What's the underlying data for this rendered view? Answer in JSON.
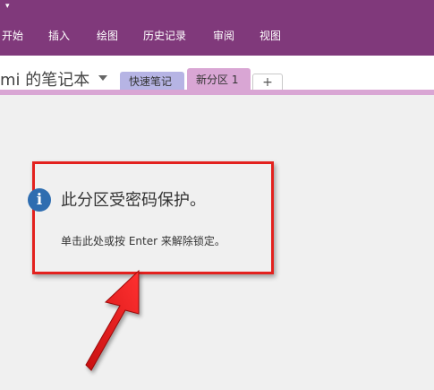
{
  "ribbon": {
    "background": "#80397b",
    "tabs": [
      "开始",
      "插入",
      "绘图",
      "历史记录",
      "审阅",
      "视图"
    ]
  },
  "notebook": {
    "name": "mi 的笔记本",
    "sections": [
      {
        "label": "快速笔记",
        "color": "#b6b4e4"
      },
      {
        "label": "新分区 1",
        "color": "#d9a6d4",
        "active": true
      }
    ],
    "add_label": "+"
  },
  "lock_notice": {
    "title": "此分区受密码保护。",
    "hint": "单击此处或按 Enter 来解除锁定。",
    "icon": "info-icon"
  },
  "annotation": {
    "highlight_color": "#e3211e"
  }
}
